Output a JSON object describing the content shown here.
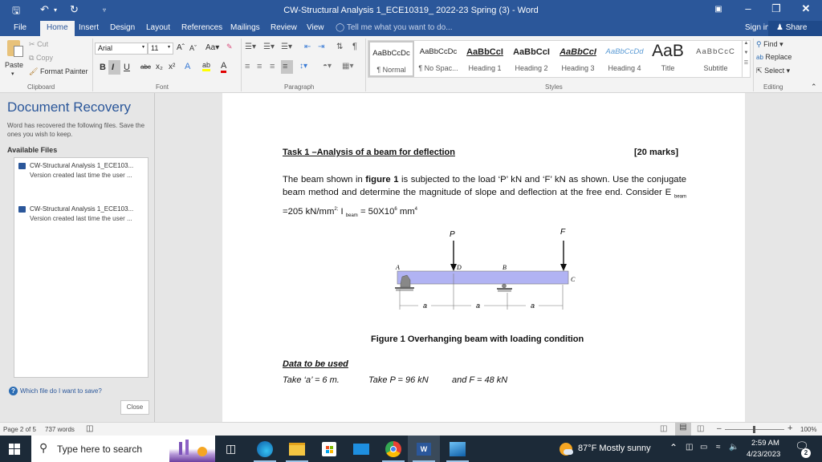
{
  "window": {
    "title": "CW-Structural Analysis 1_ECE10319_ 2022-23 Spring (3) - Word"
  },
  "quick_access": {
    "save_icon": "save-icon",
    "undo_icon": "undo-icon",
    "redo_icon": "redo-icon",
    "customize_icon": "customize-icon"
  },
  "tabs": [
    "File",
    "Home",
    "Insert",
    "Design",
    "Layout",
    "References",
    "Mailings",
    "Review",
    "View"
  ],
  "active_tab": "Home",
  "tell_me": "Tell me what you want to do...",
  "sign_in": "Sign in",
  "share": "Share",
  "ribbon": {
    "clipboard": {
      "paste": "Paste",
      "cut": "Cut",
      "copy": "Copy",
      "format_painter": "Format Painter",
      "label": "Clipboard"
    },
    "font": {
      "name": "Arial",
      "size": "11",
      "label": "Font",
      "bold": "B",
      "italic": "I",
      "underline": "U",
      "strike": "abc",
      "subscript": "x₂",
      "superscript": "x²",
      "case": "Aa"
    },
    "paragraph": {
      "label": "Paragraph"
    },
    "styles": {
      "label": "Styles",
      "items": [
        {
          "preview": "AaBbCcDc",
          "name": "¶ Normal"
        },
        {
          "preview": "AaBbCcDc",
          "name": "¶ No Spac..."
        },
        {
          "preview": "AaBbCcI",
          "name": "Heading 1"
        },
        {
          "preview": "AaBbCcI",
          "name": "Heading 2"
        },
        {
          "preview": "AaBbCcI",
          "name": "Heading 3"
        },
        {
          "preview": "AaBbCcDd",
          "name": "Heading 4"
        },
        {
          "preview": "AaB",
          "name": "Title"
        },
        {
          "preview": "AaBbCcC",
          "name": "Subtitle"
        }
      ]
    },
    "editing": {
      "find": "Find",
      "replace": "Replace",
      "select": "Select",
      "label": "Editing"
    }
  },
  "recovery": {
    "title": "Document Recovery",
    "description": "Word has recovered the following files.  Save the ones you wish to keep.",
    "available_label": "Available Files",
    "files": [
      {
        "name": "CW-Structural Analysis 1_ECE103...",
        "detail": "Version created last time the user ..."
      },
      {
        "name": "CW-Structural Analysis 1_ECE103...",
        "detail": "Version created last time the user ..."
      }
    ],
    "help_link": "Which file do I want to save?",
    "close_button": "Close"
  },
  "document": {
    "task_title": "Task 1 –Analysis of a beam for deflection",
    "marks": "[20 marks]",
    "para_1": "The beam shown in ",
    "para_bold": "figure 1",
    "para_2": " is subjected to the load ‘P’ kN  and ‘F’ kN  as shown. Use the conjugate beam method and determine the magnitude of slope and deflection at the free end. Consider E ",
    "sub_beam": "beam",
    "para_3": " =205 kN/mm",
    "sup_2": "2;",
    "para_4": " I ",
    "para_5": " = 50X10",
    "sup_6": "6",
    "para_6": " mm",
    "sup_4": "4",
    "figure": {
      "load_P": "P",
      "load_F": "F",
      "point_A": "A",
      "point_D": "D",
      "point_B": "B",
      "point_C": "C",
      "span_label": "a"
    },
    "figure_caption": "Figure 1 Overhanging beam with loading condition",
    "data_title": "Data to be used",
    "data_a": "Take ‘a’ = 6 m.",
    "data_p": "Take P = 96 kN",
    "data_f": "and  F = 48 kN"
  },
  "status": {
    "page": "Page 2 of 5",
    "words": "737 words",
    "zoom": "100%"
  },
  "taskbar": {
    "search_placeholder": "Type here to search",
    "weather": "87°F  Mostly sunny",
    "time": "2:59 AM",
    "date": "4/23/2023",
    "notifications": "2"
  }
}
